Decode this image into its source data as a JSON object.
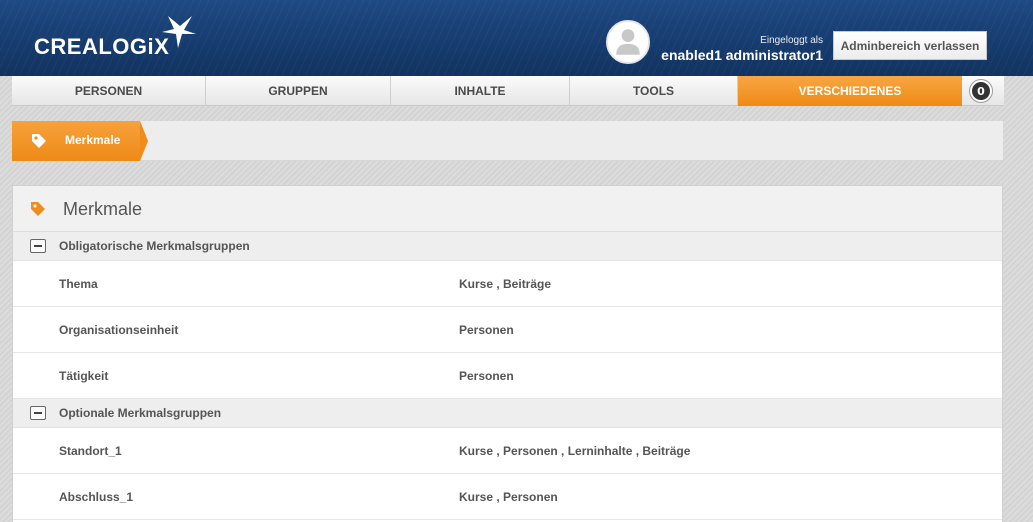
{
  "header": {
    "logo_text": "CREALOGiX",
    "login_label": "Eingeloggt als",
    "user_name": "enabled1 administrator1",
    "leave_button": "Adminbereich verlassen"
  },
  "nav": {
    "tabs": [
      {
        "label": "PERSONEN"
      },
      {
        "label": "GRUPPEN"
      },
      {
        "label": "INHALTE"
      },
      {
        "label": "TOOLS"
      },
      {
        "label": "VERSCHIEDENES",
        "active": true
      }
    ],
    "notification_count": "0"
  },
  "breadcrumb": {
    "label": "Merkmale"
  },
  "panel": {
    "title": "Merkmale",
    "groups": [
      {
        "label": "Obligatorische Merkmalsgruppen",
        "items": [
          {
            "name": "Thema",
            "value": "Kurse , Beiträge"
          },
          {
            "name": "Organisationseinheit",
            "value": "Personen"
          },
          {
            "name": "Tätigkeit",
            "value": "Personen"
          }
        ]
      },
      {
        "label": "Optionale Merkmalsgruppen",
        "items": [
          {
            "name": "Standort_1",
            "value": "Kurse , Personen , Lerninhalte , Beiträge"
          },
          {
            "name": "Abschluss_1",
            "value": "Kurse , Personen"
          }
        ]
      }
    ]
  },
  "colors": {
    "accent": "#f0901f",
    "header_bg": "#1a4478"
  }
}
